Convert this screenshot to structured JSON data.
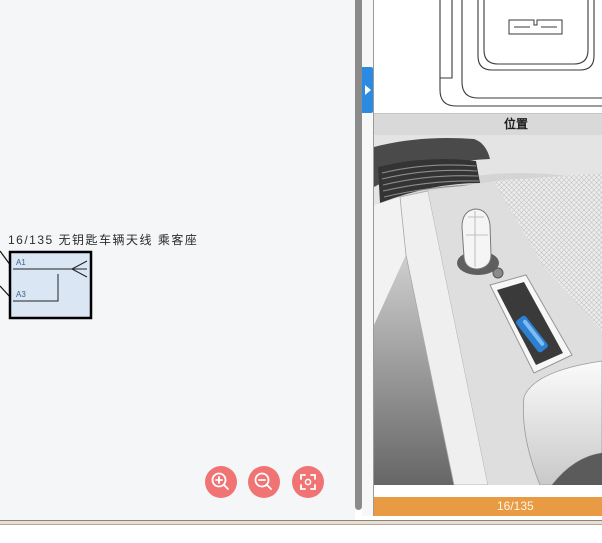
{
  "diagram": {
    "component_label": "16/135 无钥匙车辆天线 乘客座",
    "pins": [
      {
        "label": "A1"
      },
      {
        "label": "A3"
      }
    ]
  },
  "location_panel": {
    "header": "位置",
    "page_indicator": "16/135"
  },
  "icons": {
    "zoom_in": "zoom-in-icon",
    "zoom_out": "zoom-out-icon",
    "fit_view": "fit-to-screen-icon",
    "panel_toggle": "chevron-right-icon",
    "component_symbol": "antenna-icon"
  },
  "colors": {
    "zoom_button": "#f07474",
    "panel_toggle": "#2b8ae2",
    "page_indicator_bar": "#e89b43",
    "location_header_bar": "#d9d9d9",
    "component_fill": "#dae6f4"
  }
}
